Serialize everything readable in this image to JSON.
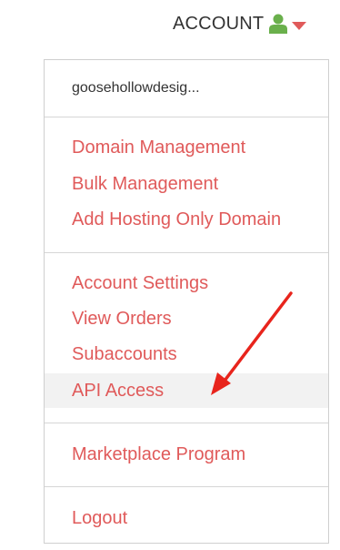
{
  "header": {
    "account_label": "ACCOUNT",
    "user_icon": "user-icon",
    "caret_icon": "caret-down-icon"
  },
  "dropdown": {
    "username": "goosehollowdesig...",
    "sections": [
      {
        "items": [
          {
            "label": "Domain Management"
          },
          {
            "label": "Bulk Management"
          },
          {
            "label": "Add Hosting Only Domain"
          }
        ]
      },
      {
        "items": [
          {
            "label": "Account Settings"
          },
          {
            "label": "View Orders"
          },
          {
            "label": "Subaccounts"
          },
          {
            "label": "API Access",
            "highlighted": true
          }
        ]
      },
      {
        "items": [
          {
            "label": "Marketplace Program"
          }
        ]
      },
      {
        "items": [
          {
            "label": "Logout"
          }
        ]
      }
    ]
  },
  "colors": {
    "link": "#e05a5a",
    "user_icon": "#6ab04c",
    "caret": "#e05a5a",
    "arrow": "#e8241c",
    "highlight_bg": "#f2f2f2"
  }
}
